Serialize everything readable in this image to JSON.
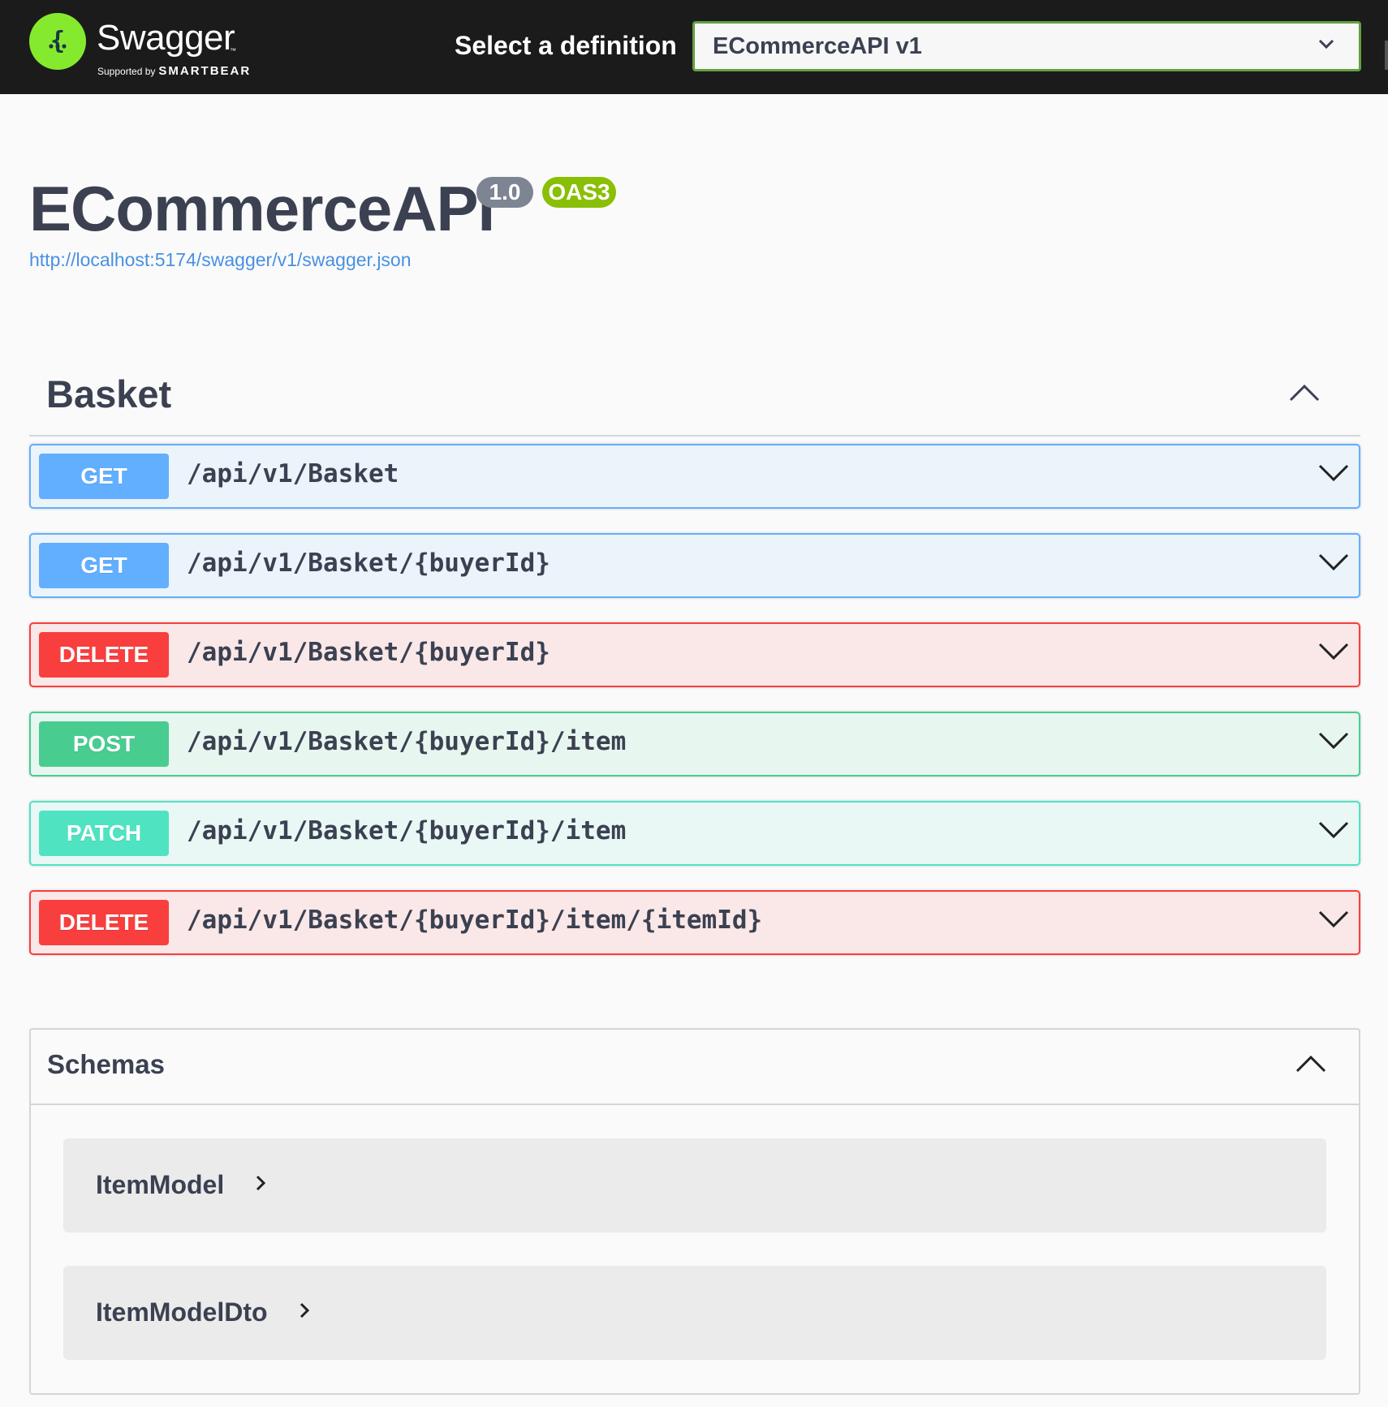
{
  "topbar": {
    "brand": "Swagger",
    "brand_tm": "™",
    "supported_by": "Supported by",
    "sponsor": "SMARTBEAR",
    "logo_icon": "swagger-braces-icon",
    "select_label": "Select a definition",
    "selected_definition": "ECommerceAPI v1"
  },
  "info": {
    "title": "ECommerceAPI",
    "version": "1.0",
    "oas_badge": "OAS3",
    "spec_url": "http://localhost:5174/swagger/v1/swagger.json"
  },
  "tag": {
    "name": "Basket",
    "expanded": true
  },
  "operations": [
    {
      "method": "GET",
      "path": "/api/v1/Basket"
    },
    {
      "method": "GET",
      "path": "/api/v1/Basket/{buyerId}"
    },
    {
      "method": "DELETE",
      "path": "/api/v1/Basket/{buyerId}"
    },
    {
      "method": "POST",
      "path": "/api/v1/Basket/{buyerId}/item"
    },
    {
      "method": "PATCH",
      "path": "/api/v1/Basket/{buyerId}/item"
    },
    {
      "method": "DELETE",
      "path": "/api/v1/Basket/{buyerId}/item/{itemId}"
    }
  ],
  "schemas": {
    "title": "Schemas",
    "expanded": true,
    "models": [
      {
        "name": "ItemModel"
      },
      {
        "name": "ItemModelDto"
      }
    ]
  },
  "colors": {
    "get": "#61affe",
    "delete": "#f93e3e",
    "post": "#49cc90",
    "patch": "#50e3c2",
    "topbar_bg": "#1b1b1b",
    "logo_green": "#85ea2d",
    "link": "#4990e2"
  }
}
